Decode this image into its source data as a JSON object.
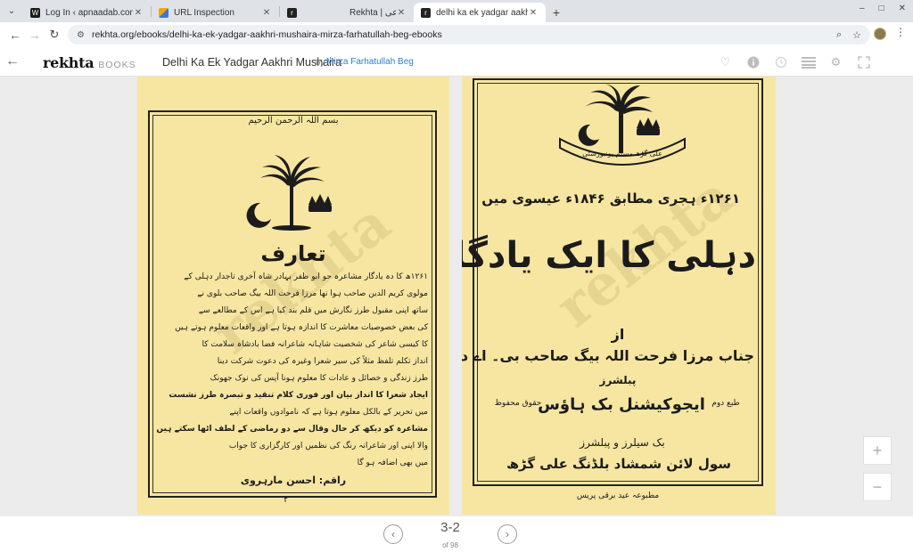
{
  "browser": {
    "tabs": [
      {
        "title": "Log In ‹ apnaadab.com — W",
        "favicon_color": "#1a1a1a",
        "active": false
      },
      {
        "title": "URL Inspection",
        "favicon_color": "#f2a60c",
        "active": false
      },
      {
        "title": "",
        "favicon_color": "#222222",
        "active": false
      },
      {
        "title": "Rekhta | رباعی",
        "favicon_color": "#222222",
        "active": false
      },
      {
        "title": "delhi ka ek yadgar aakhri mu",
        "favicon_color": "#222222",
        "active": true
      }
    ],
    "new_tab_icon": "plus-icon",
    "url": "rekhta.org/ebooks/delhi-ka-ek-yadgar-aakhri-mushaira-mirza-farhatullah-beg-ebooks"
  },
  "header": {
    "brand_logo": "rekhta",
    "brand_sub": "BOOKS",
    "book_title": "Delhi Ka Ek Yadgar Aakhri Mushaira",
    "by": "by",
    "author": "Mirza Farhatullah Beg",
    "icons": [
      "heart-icon",
      "info-icon",
      "history-icon",
      "list-icon",
      "settings-icon",
      "fullscreen-icon"
    ]
  },
  "viewer": {
    "left_page": {
      "heading_urdu": "تعارف",
      "bismillah": "بسم اللہ الرحمن الرحیم",
      "lines": [
        "۱۲۶۱ھ کا دہ یادگار مشاعرہ جو ابو ظفر بہادر شاہ آخری تاجدار دہلی کے",
        "مولوی کریم الدین صاحب ہوا تھا مرزا فرحت اللہ بیگ صاحب بلوی نے",
        "ساتھ اپنی مقبول طرز نگارش میں قلم بند کیا ہے اس کے مطالعے سے",
        "کی بعض خصوصیات معاشرت کا اندازہ ہوتا ہے اور واقعات معلوم ہوتے ہیں",
        "کا کیسی شاعر کی شخصیت شاہانہ شاعرانہ فضا بادشاہ سلامت کا",
        "انداز تکلم تلفظ مثلاً کی سیر شعرا وغیرہ کی دعوت شرکت دینا",
        "طرز زندگی و خصائل و عادات کا معلوم ہونا آپس کی نوک جھونک",
        "ایجاد شعرا کا انداز بیان اور فوری کلام تنقید و تبصرہ طرز نشست",
        "میں تحریر کے بالکل معلوم ہوتا ہے کہ ناموادوں واقعات اپنے",
        "مشاعرہ کو دیکھ کر حال وقال سے دو رماضی کے لطف اٹھا سکتے ہیں",
        "والا اپنی اور شاعرانہ رنگ کی نظمیں اور کارگزاری کا جواب",
        "میں بھی اضافہ ہو گا"
      ],
      "signature": "راقم: احسن مارہروی",
      "page_number": "۲"
    },
    "right_page": {
      "emblem_text": "علی گڑھ مسلم یونیورسٹی",
      "date_line": "۱۲۶۱ء ہجری مطابق ۱۸۴۶ء عیسوی میں",
      "title_line1": "دہلی کا ایک یادگار مشاعرہ",
      "az": "از",
      "author_line": "جناب مرزا فرحت اللہ بیگ صاحب بی۔ اے دہلوی",
      "publishers_label": "پبلشرز",
      "publisher": "ایجوکیشنل بک ہاؤس",
      "rights_left": "حقوق محفوظ",
      "rights_right": "طبع دوم",
      "sellers_label": "بک سیلرز و پبلشرز",
      "address": "سول لائن شمشاد بلڈنگ علی گڑھ",
      "press": "مطبوعہ عید برقی پریس"
    },
    "watermark": "rekhta"
  },
  "zoom": {
    "in_label": "+",
    "out_label": "−"
  },
  "footer": {
    "current": "3-2",
    "total": "of 98"
  }
}
